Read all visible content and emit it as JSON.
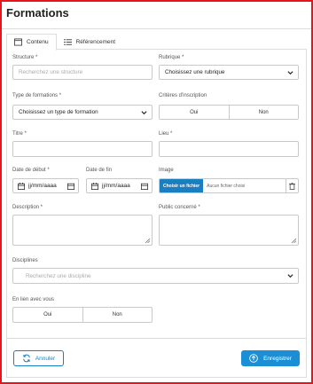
{
  "page": {
    "title": "Formations"
  },
  "tabs": [
    {
      "label": "Contenu",
      "icon": "window-icon",
      "active": true
    },
    {
      "label": "Référencement",
      "icon": "list-icon",
      "active": false
    }
  ],
  "form": {
    "structure": {
      "label": "Structure *",
      "placeholder": "Recherchez une structure"
    },
    "rubrique": {
      "label": "Rubrique *",
      "value": "Choisissez une rubrique"
    },
    "type_formation": {
      "label": "Type de formations *",
      "value": "Choisissez un type de formation"
    },
    "criteres": {
      "label": "Critères d'inscription",
      "options": [
        "Oui",
        "Non"
      ]
    },
    "titre": {
      "label": "Titre *",
      "value": ""
    },
    "lieu": {
      "label": "Lieu *",
      "value": ""
    },
    "date_debut": {
      "label": "Date de début *",
      "value": "jj/mm/aaaa"
    },
    "date_fin": {
      "label": "Date de fin",
      "value": "jj/mm/aaaa"
    },
    "image": {
      "label": "Image",
      "button": "Choisir un fichier",
      "status": "Aucun fichier choisi"
    },
    "description": {
      "label": "Description *",
      "value": ""
    },
    "public": {
      "label": "Public concerné *",
      "value": ""
    },
    "disciplines": {
      "label": "Disciplines",
      "placeholder": "Recherchez une discipline"
    },
    "en_lien": {
      "label": "En lien avec vous",
      "options": [
        "Oui",
        "Non"
      ]
    }
  },
  "actions": {
    "cancel": "Annuler",
    "save": "Enregistrer"
  },
  "colors": {
    "accent": "#1a8fd6",
    "border_frame": "#e8141b"
  }
}
